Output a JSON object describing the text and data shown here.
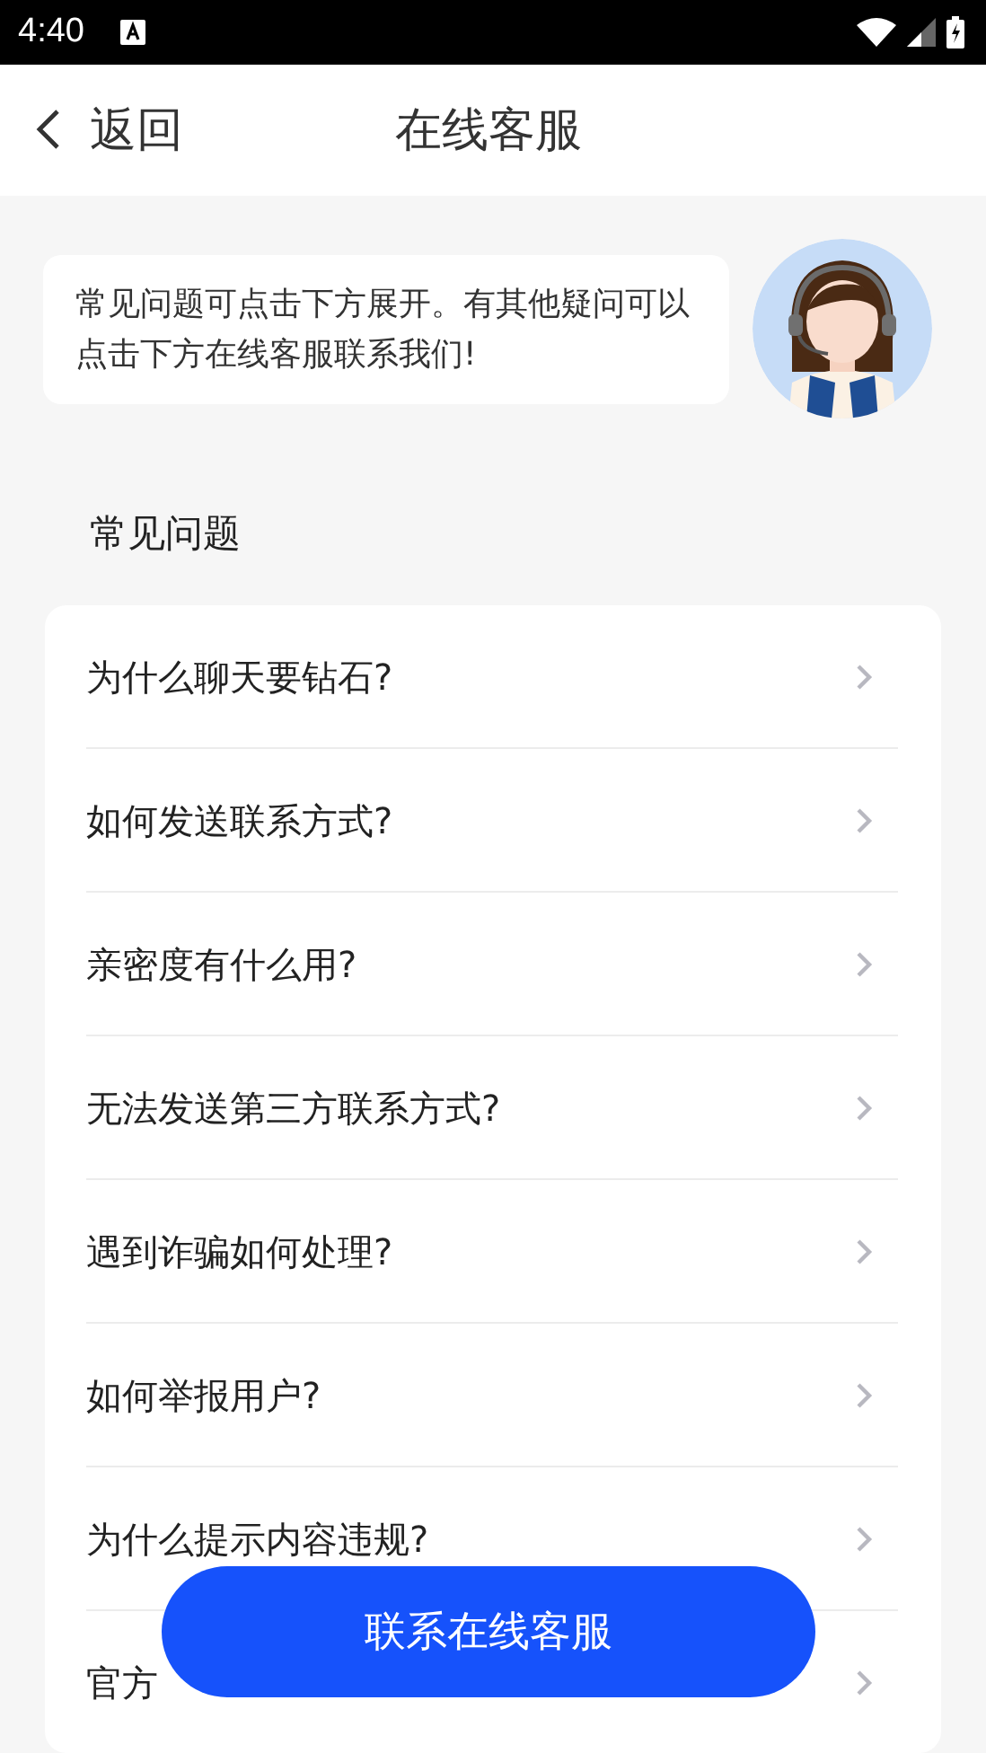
{
  "status_bar": {
    "time": "4:40"
  },
  "header": {
    "back_label": "返回",
    "title": "在线客服"
  },
  "greeting": {
    "message": "常见问题可点击下方展开。有其他疑问可以点击下方在线客服联系我们!"
  },
  "faq": {
    "heading": "常见问题",
    "items": [
      {
        "question": "为什么聊天要钻石?"
      },
      {
        "question": "如何发送联系方式?"
      },
      {
        "question": "亲密度有什么用?"
      },
      {
        "question": "无法发送第三方联系方式?"
      },
      {
        "question": "遇到诈骗如何处理?"
      },
      {
        "question": "如何举报用户?"
      },
      {
        "question": "为什么提示内容违规?"
      },
      {
        "question": "官方"
      }
    ]
  },
  "contact_button": {
    "label": "联系在线客服"
  }
}
